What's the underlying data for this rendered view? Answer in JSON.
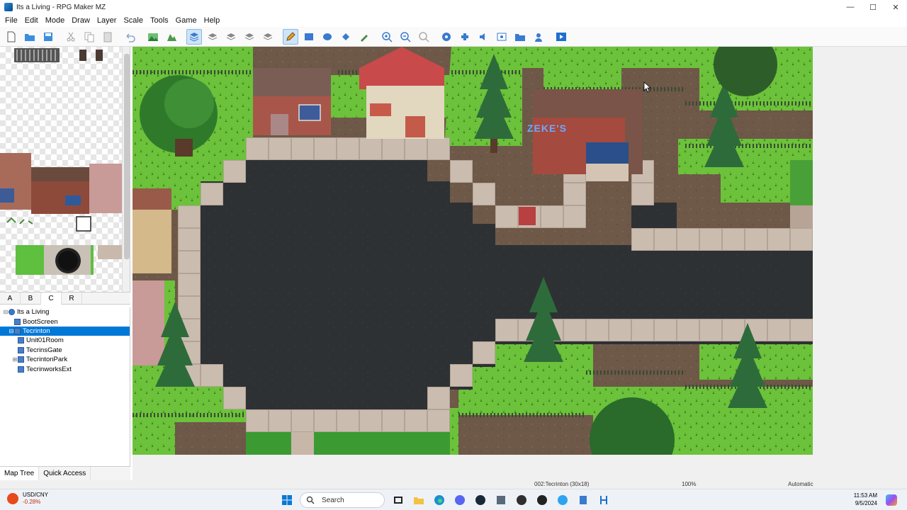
{
  "window": {
    "title": "Its a Living - RPG Maker MZ"
  },
  "menu": [
    "File",
    "Edit",
    "Mode",
    "Draw",
    "Layer",
    "Scale",
    "Tools",
    "Game",
    "Help"
  ],
  "toolbar": {
    "icons": [
      "new-icon",
      "open-icon",
      "save-icon",
      "cut-icon",
      "copy-icon",
      "paste-icon",
      "undo-icon",
      "map-mode-icon",
      "event-mode-icon",
      "layer-auto-icon",
      "layer-1-icon",
      "layer-2-icon",
      "layer-3-icon",
      "layer-4-icon",
      "pencil-icon",
      "rectangle-icon",
      "ellipse-icon",
      "fill-icon",
      "shadow-pen-icon",
      "zoom-in-icon",
      "zoom-out-icon",
      "zoom-actual-icon",
      "database-icon",
      "plugin-manager-icon",
      "sound-test-icon",
      "event-searcher-icon",
      "resource-manager-icon",
      "character-generator-icon",
      "playtest-icon"
    ],
    "active": [
      "layer-auto-icon",
      "pencil-icon"
    ]
  },
  "tileset_tabs": [
    "A",
    "B",
    "C",
    "R"
  ],
  "tileset_active_tab": "C",
  "map_tree": [
    {
      "label": "Its a Living",
      "level": 0,
      "expander": "⊟",
      "icon": "project-icon"
    },
    {
      "label": "BootScreen",
      "level": 1,
      "expander": "",
      "icon": "map-icon"
    },
    {
      "label": "Tecrinton",
      "level": 1,
      "expander": "⊟",
      "icon": "map-icon",
      "selected": true
    },
    {
      "label": "Unit01Room",
      "level": 2,
      "expander": "",
      "icon": "map-icon"
    },
    {
      "label": "TecrinsGate",
      "level": 2,
      "expander": "",
      "icon": "map-icon"
    },
    {
      "label": "TecrintonPark",
      "level": 2,
      "expander": "⊞",
      "icon": "map-icon"
    },
    {
      "label": "TecrinworksExt",
      "level": 2,
      "expander": "",
      "icon": "map-icon"
    }
  ],
  "bottom_tabs": [
    "Map Tree",
    "Quick Access"
  ],
  "bottom_active_tab": "Map Tree",
  "map": {
    "sign_text": "ZEKE'S"
  },
  "status": {
    "map": "002:Tecrinton (30x18)",
    "zoom": "100%",
    "mode": "Automatic"
  },
  "taskbar": {
    "widget_title": "USD/CNY",
    "widget_change": "-0.28%",
    "search_placeholder": "Search",
    "time": "11:53 AM",
    "date": "9/5/2024"
  }
}
